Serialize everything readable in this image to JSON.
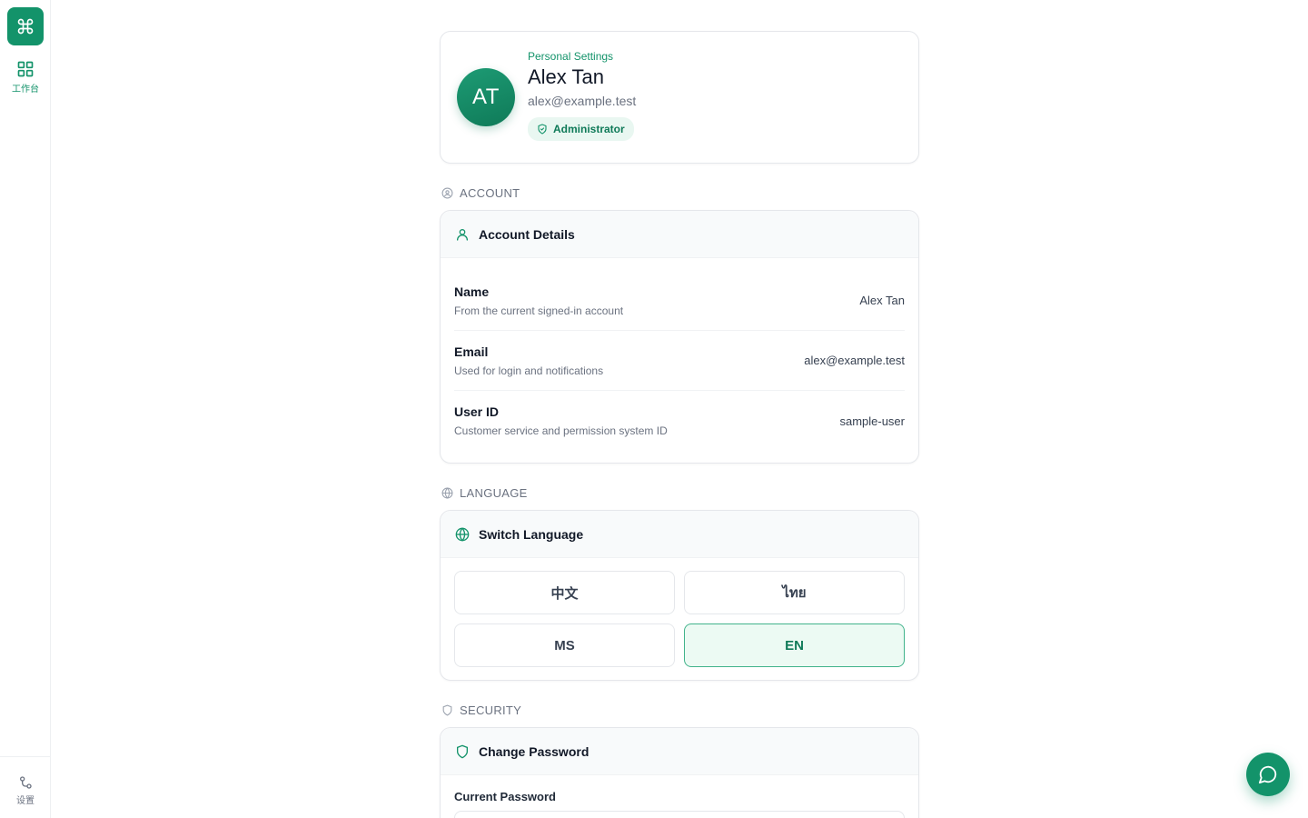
{
  "sidebar": {
    "logo_icon": "command-icon",
    "nav": [
      {
        "label": "工作台",
        "icon": "grid-icon"
      }
    ],
    "settings_label": "设置"
  },
  "profile": {
    "eyebrow": "Personal Settings",
    "initials": "AT",
    "name": "Alex Tan",
    "email": "alex@example.test",
    "role": "Administrator"
  },
  "account": {
    "section_label": "ACCOUNT",
    "card_title": "Account Details",
    "rows": [
      {
        "title": "Name",
        "desc": "From the current signed-in account",
        "value": "Alex Tan"
      },
      {
        "title": "Email",
        "desc": "Used for login and notifications",
        "value": "alex@example.test"
      },
      {
        "title": "User ID",
        "desc": "Customer service and permission system ID",
        "value": "sample-user"
      }
    ]
  },
  "language": {
    "section_label": "LANGUAGE",
    "card_title": "Switch Language",
    "options": [
      "中文",
      "ไทย",
      "MS",
      "EN"
    ],
    "selected": "EN"
  },
  "security": {
    "section_label": "SECURITY",
    "card_title": "Change Password",
    "current_password_label": "Current Password"
  },
  "colors": {
    "accent": "#13936a",
    "accent_light": "#ecfaf3"
  }
}
